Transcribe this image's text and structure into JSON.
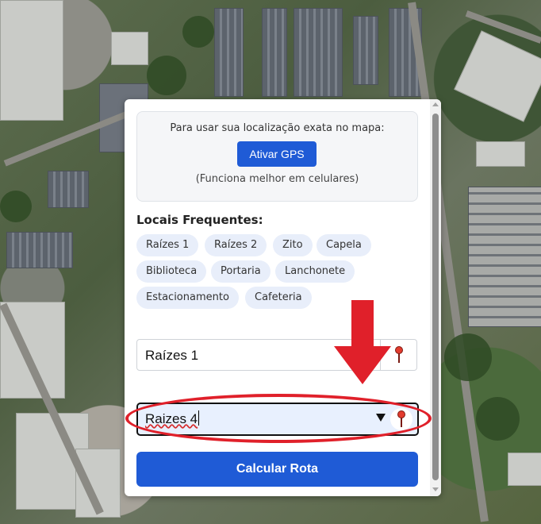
{
  "gps": {
    "prompt": "Para usar sua localização exata no mapa:",
    "button_label": "Ativar GPS",
    "note": "(Funciona melhor em celulares)"
  },
  "frequent": {
    "title": "Locais Frequentes:",
    "chips": [
      "Raízes 1",
      "Raízes 2",
      "Zito",
      "Capela",
      "Biblioteca",
      "Portaria",
      "Lanchonete",
      "Estacionamento",
      "Cafeteria"
    ]
  },
  "origin": {
    "value": "Raízes 1",
    "pin_icon": "map-pin-icon"
  },
  "destination": {
    "value": "Raizes 4",
    "dropdown_icon": "dropdown-arrow-icon",
    "pin_icon": "map-pin-icon"
  },
  "calculate_button": "Calcular Rota",
  "annotation_color": "#e0202a",
  "accent": "#1f5bd6"
}
